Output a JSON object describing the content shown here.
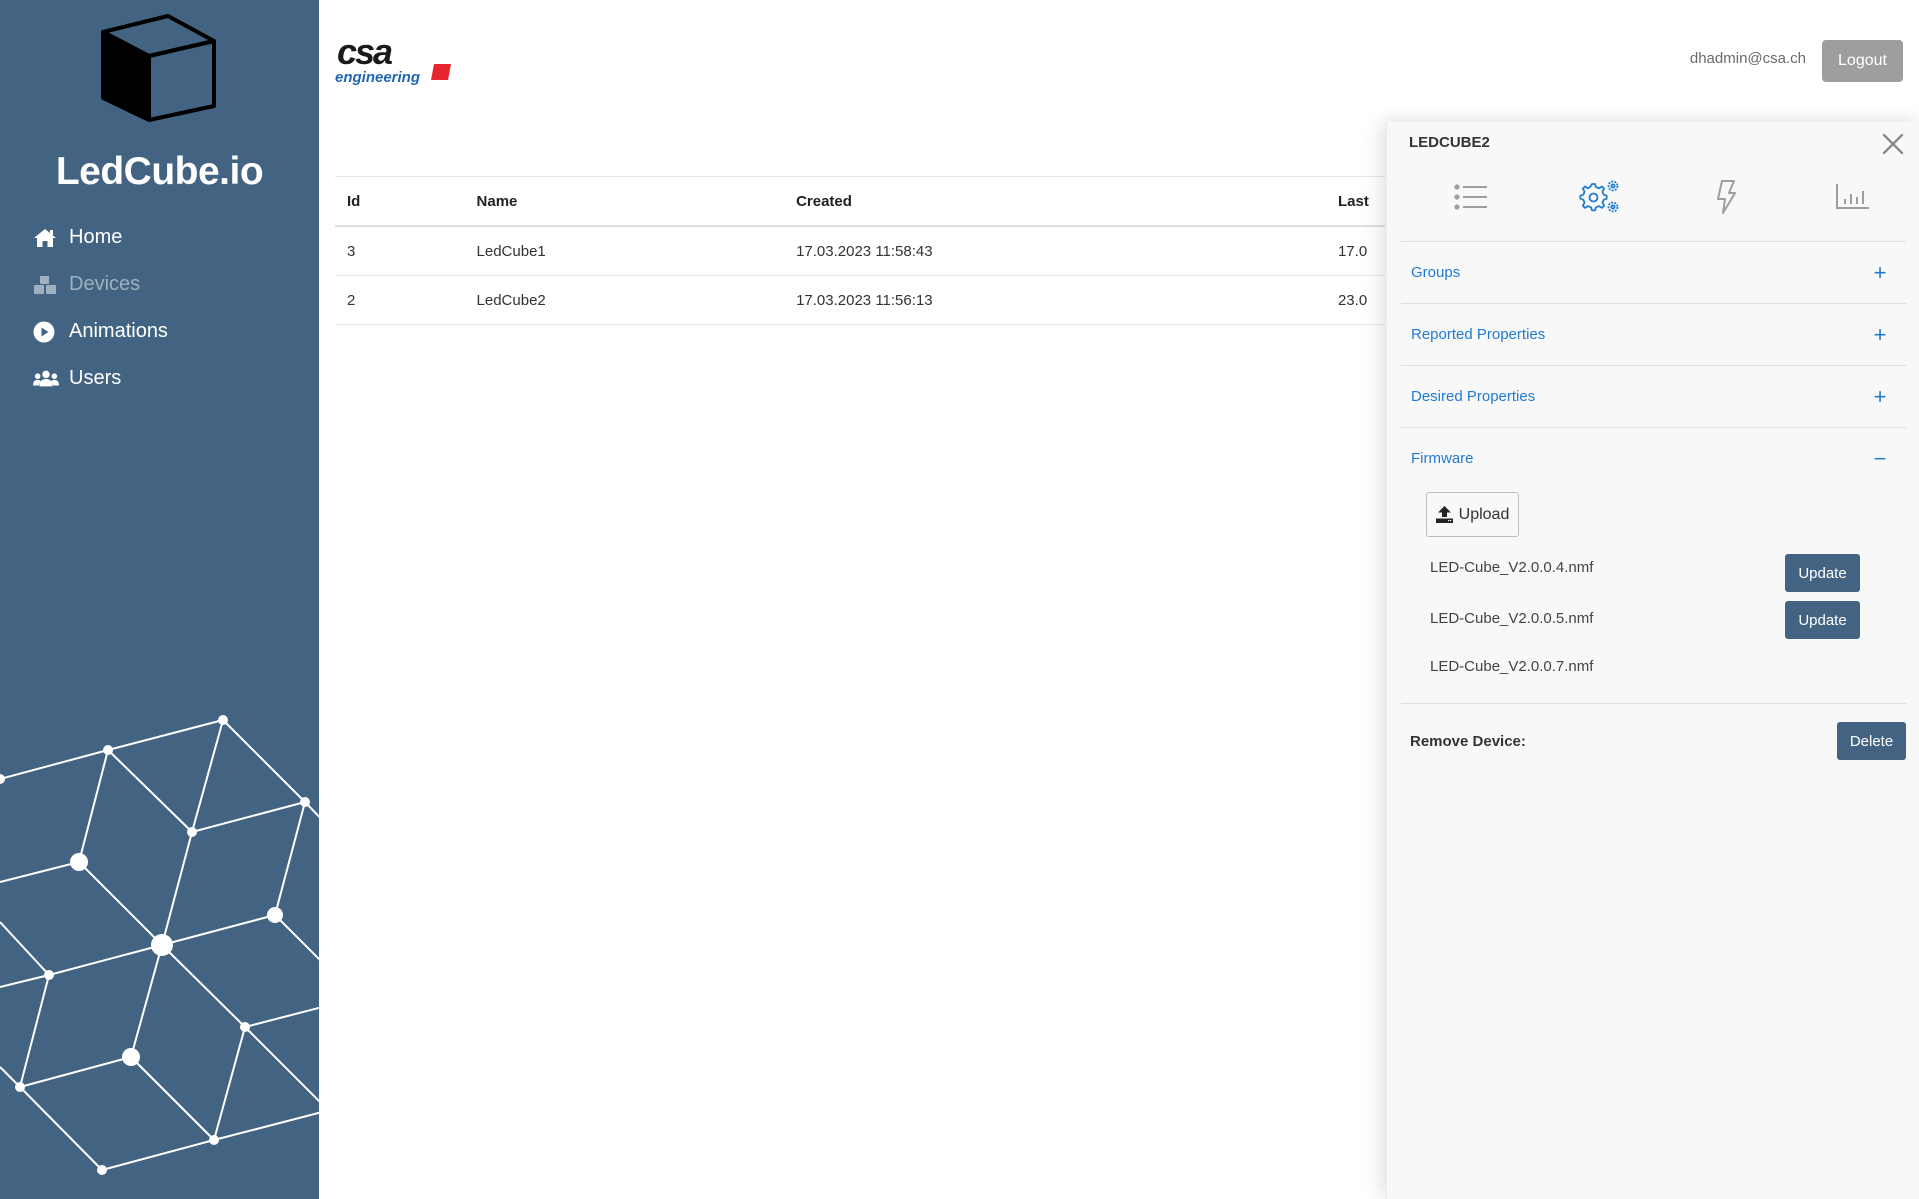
{
  "app": {
    "brand": "LedCube.io",
    "company_logo": "csa engineering"
  },
  "sidebar": {
    "items": [
      {
        "label": "Home",
        "icon": "home-icon",
        "active": true
      },
      {
        "label": "Devices",
        "icon": "cubes-icon",
        "active": false,
        "disabled": true
      },
      {
        "label": "Animations",
        "icon": "play-circle-icon",
        "active": true
      },
      {
        "label": "Users",
        "icon": "users-icon",
        "active": true
      }
    ]
  },
  "header": {
    "user_email": "dhadmin@csa.ch",
    "logout_label": "Logout"
  },
  "table": {
    "columns": [
      "Id",
      "Name",
      "Created",
      "Last"
    ],
    "rows": [
      {
        "id": "3",
        "name": "LedCube1",
        "created": "17.03.2023 11:58:43",
        "last": "17.0"
      },
      {
        "id": "2",
        "name": "LedCube2",
        "created": "17.03.2023 11:56:13",
        "last": "23.0"
      }
    ]
  },
  "panel": {
    "title": "LEDCUBE2",
    "tabs": [
      {
        "name": "list-icon",
        "active": false
      },
      {
        "name": "gears-icon",
        "active": true
      },
      {
        "name": "bolt-icon",
        "active": false
      },
      {
        "name": "chart-bar-icon",
        "active": false
      }
    ],
    "sections": [
      {
        "label": "Groups",
        "sign": "+",
        "expanded": false
      },
      {
        "label": "Reported Properties",
        "sign": "+",
        "expanded": false
      },
      {
        "label": "Desired Properties",
        "sign": "+",
        "expanded": false
      },
      {
        "label": "Firmware",
        "sign": "−",
        "expanded": true
      }
    ],
    "firmware": {
      "upload_label": "Upload",
      "files": [
        {
          "name": "LED-Cube_V2.0.0.4.nmf",
          "action": "Update"
        },
        {
          "name": "LED-Cube_V2.0.0.5.nmf",
          "action": "Update"
        },
        {
          "name": "LED-Cube_V2.0.0.7.nmf",
          "action": null
        }
      ]
    },
    "remove_label": "Remove Device:",
    "delete_label": "Delete"
  },
  "colors": {
    "sidebar": "#426482",
    "accent_blue": "#1f7bd1",
    "primary_button": "#426482",
    "logout_button": "#9e9e9e",
    "logo_red": "#e8262f"
  }
}
